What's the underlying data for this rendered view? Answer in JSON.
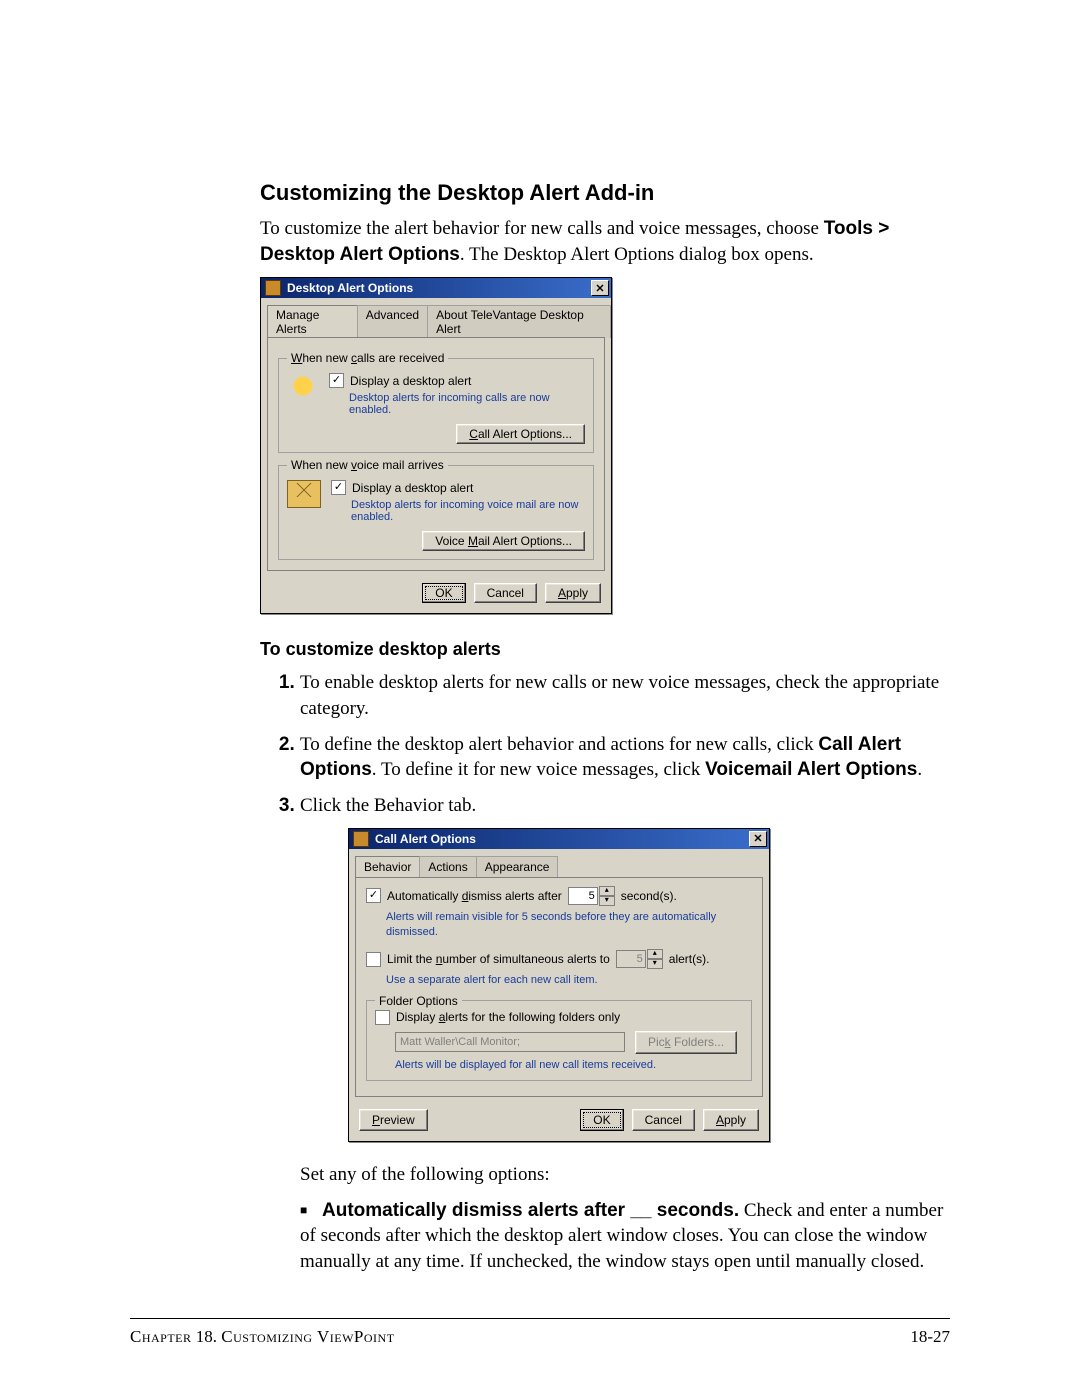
{
  "heading": "Customizing the Desktop Alert Add-in",
  "intro": {
    "pre": "To customize the alert behavior for new calls and voice messages, choose ",
    "menu": "Tools > Desktop Alert Options",
    "post": ". The Desktop Alert Options dialog box opens."
  },
  "dlg1": {
    "title": "Desktop Alert Options",
    "close_glyph": "✕",
    "tabs": {
      "manage": "Manage Alerts",
      "advanced": "Advanced",
      "about": "About TeleVantage Desktop Alert"
    },
    "calls": {
      "legend": "When new calls are received",
      "display_label": "Display a desktop alert",
      "display_checked": "✓",
      "hint": "Desktop alerts for incoming calls are now enabled.",
      "options_btn": "Call Alert Options..."
    },
    "vm": {
      "legend": "When new voice mail arrives",
      "display_label": "Display a desktop alert",
      "display_checked": "✓",
      "hint": "Desktop alerts for incoming voice mail are now enabled.",
      "options_btn": "Voice Mail Alert Options..."
    },
    "btns": {
      "ok": "OK",
      "cancel": "Cancel",
      "apply": "Apply"
    }
  },
  "subhead": "To customize desktop alerts",
  "steps": {
    "s1": "To enable desktop alerts for new calls or new voice messages, check the appropriate category.",
    "s2_pre": "To define the desktop alert behavior and actions for new calls, click ",
    "s2_b1": "Call Alert Options",
    "s2_mid": ". To define it for new voice messages, click ",
    "s2_b2": "Voicemail Alert Options",
    "s2_post": ".",
    "s3": "Click the Behavior tab."
  },
  "dlg2": {
    "title": "Call Alert Options",
    "close_glyph": "✕",
    "tabs": {
      "behavior": "Behavior",
      "actions": "Actions",
      "appearance": "Appearance"
    },
    "auto_dismiss": {
      "label": "Automatically dismiss alerts after",
      "checked": "✓",
      "value": "5",
      "unit": "second(s).",
      "hint": "Alerts will remain visible for 5 seconds before they are automatically dismissed."
    },
    "limit": {
      "label": "Limit the number of simultaneous alerts to",
      "checked": "",
      "value": "5",
      "unit": "alert(s).",
      "hint": "Use a separate alert for each new call item."
    },
    "folders": {
      "legend": "Folder Options",
      "only_label": "Display alerts for the following folders only",
      "only_checked": "",
      "field": "Matt Waller\\Call Monitor;",
      "pick_btn": "Pick Folders...",
      "hint": "Alerts will be displayed for all new call items received."
    },
    "btns": {
      "preview": "Preview",
      "ok": "OK",
      "cancel": "Cancel",
      "apply": "Apply"
    }
  },
  "after_fig": "Set any of the following options:",
  "bullet": {
    "sq": "■",
    "b": "Automatically dismiss alerts after __ seconds.",
    "rest": " Check and enter a number of seconds after which the desktop alert window closes. You can close the window manually at any time. If unchecked, the window stays open until manually closed."
  },
  "footer": {
    "chapter_word": "Chapter",
    "chapter_num": " 18. ",
    "chapter_title": "Customizing ViewPoint",
    "page": "18-27"
  }
}
